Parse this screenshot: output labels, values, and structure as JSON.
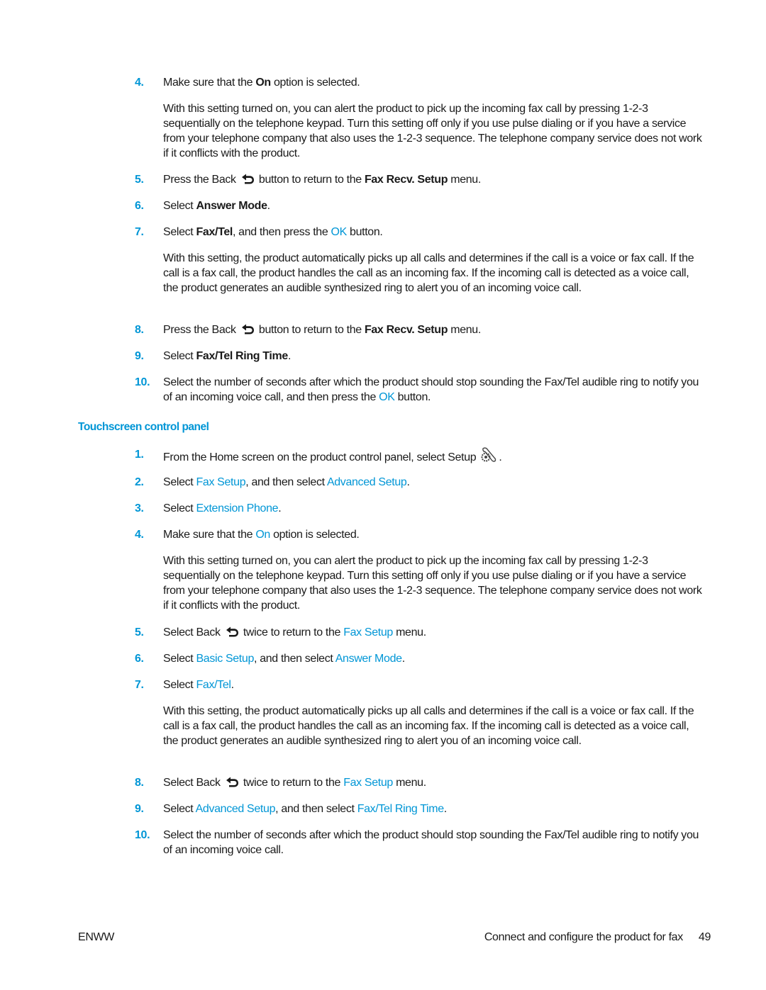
{
  "section1": {
    "steps": [
      {
        "num": "4.",
        "pre": "Make sure that the ",
        "bold": "On",
        "post": " option is selected."
      },
      {
        "num": "5.",
        "pre": "Press the Back ",
        "mid": " button to return to the ",
        "bold": "Fax Recv. Setup",
        "post": " menu."
      },
      {
        "num": "6.",
        "pre": "Select ",
        "bold": "Answer Mode",
        "post": "."
      },
      {
        "num": "7.",
        "pre": "Select ",
        "bold": "Fax/Tel",
        "mid": ", and then press the ",
        "link": "OK",
        "post": " button."
      },
      {
        "num": "8.",
        "pre": "Press the Back ",
        "mid": " button to return to the ",
        "bold": "Fax Recv. Setup",
        "post": " menu."
      },
      {
        "num": "9.",
        "pre": "Select ",
        "bold": "Fax/Tel Ring Time",
        "post": "."
      },
      {
        "num": "10.",
        "pre": "Select the number of seconds after which the product should stop sounding the Fax/Tel audible ring to notify you of an incoming voice call, and then press the ",
        "link": "OK",
        "post": " button."
      }
    ],
    "para_on": "With this setting turned on, you can alert the product to pick up the incoming fax call by pressing 1-2-3 sequentially on the telephone keypad. Turn this setting off only if you use pulse dialing or if you have a service from your telephone company that also uses the 1-2-3 sequence. The telephone company service does not work if it conflicts with the product.",
    "para_faxtel": "With this setting, the product automatically picks up all calls and determines if the call is a voice or fax call. If the call is a fax call, the product handles the call as an incoming fax. If the incoming call is detected as a voice call, the product generates an audible synthesized ring to alert you of an incoming voice call."
  },
  "section2": {
    "heading": "Touchscreen control panel",
    "steps": [
      {
        "num": "1.",
        "pre": "From the Home screen on the product control panel, select Setup ",
        "post": "."
      },
      {
        "num": "2.",
        "pre": "Select ",
        "link1": "Fax Setup",
        "mid": ", and then select ",
        "link2": "Advanced Setup",
        "post": "."
      },
      {
        "num": "3.",
        "pre": "Select ",
        "link1": "Extension Phone",
        "post": "."
      },
      {
        "num": "4.",
        "pre": "Make sure that the ",
        "link1": "On",
        "post": " option is selected."
      },
      {
        "num": "5.",
        "pre": "Select Back ",
        "mid": " twice to return to the ",
        "link1": "Fax Setup",
        "post": " menu."
      },
      {
        "num": "6.",
        "pre": "Select ",
        "link1": "Basic Setup",
        "mid": ", and then select ",
        "link2": "Answer Mode",
        "post": "."
      },
      {
        "num": "7.",
        "pre": "Select ",
        "link1": "Fax/Tel",
        "post": "."
      },
      {
        "num": "8.",
        "pre": "Select Back ",
        "mid": " twice to return to the ",
        "link1": "Fax Setup",
        "post": " menu."
      },
      {
        "num": "9.",
        "pre": "Select ",
        "link1": "Advanced Setup",
        "mid": ", and then select ",
        "link2": "Fax/Tel Ring Time",
        "post": "."
      },
      {
        "num": "10.",
        "pre": "Select the number of seconds after which the product should stop sounding the Fax/Tel audible ring to notify you of an incoming voice call."
      }
    ],
    "para_on": "With this setting turned on, you can alert the product to pick up the incoming fax call by pressing 1-2-3 sequentially on the telephone keypad. Turn this setting off only if you use pulse dialing or if you have a service from your telephone company that also uses the 1-2-3 sequence. The telephone company service does not work if it conflicts with the product.",
    "para_faxtel": "With this setting, the product automatically picks up all calls and determines if the call is a voice or fax call. If the call is a fax call, the product handles the call as an incoming fax. If the incoming call is detected as a voice call, the product generates an audible synthesized ring to alert you of an incoming voice call."
  },
  "footer": {
    "left": "ENWW",
    "chapter": "Connect and configure the product for fax",
    "page": "49"
  },
  "icons": {
    "back": "back-arrow-icon",
    "setup": "setup-wrench-gear-icon"
  },
  "colors": {
    "accent": "#0096d6",
    "text": "#1a1a1a"
  }
}
